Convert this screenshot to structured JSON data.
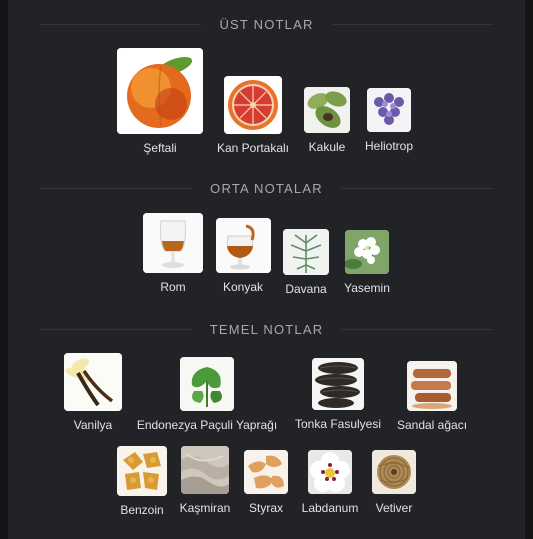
{
  "sections": {
    "top": {
      "title": "ÜST NOTLAR"
    },
    "middle": {
      "title": "ORTA NOTALAR"
    },
    "base": {
      "title": "TEMEL NOTLAR"
    }
  },
  "notes": {
    "top": [
      {
        "label": "Şeftali",
        "icon": "peach-icon"
      },
      {
        "label": "Kan Portakalı",
        "icon": "blood-orange-icon"
      },
      {
        "label": "Kakule",
        "icon": "cardamom-icon"
      },
      {
        "label": "Heliotrop",
        "icon": "heliotrope-icon"
      }
    ],
    "middle": [
      {
        "label": "Rom",
        "icon": "rum-glass-icon"
      },
      {
        "label": "Konyak",
        "icon": "cognac-glass-icon"
      },
      {
        "label": "Davana",
        "icon": "davana-icon"
      },
      {
        "label": "Yasemin",
        "icon": "jasmine-icon"
      }
    ],
    "base": [
      {
        "label": "Vanilya",
        "icon": "vanilla-icon"
      },
      {
        "label": "Endonezya Paçuli Yaprağı",
        "icon": "patchouli-leaf-icon"
      },
      {
        "label": "Tonka Fasulyesi",
        "icon": "tonka-bean-icon"
      },
      {
        "label": "Sandal ağacı",
        "icon": "sandalwood-icon"
      },
      {
        "label": "Benzoin",
        "icon": "benzoin-icon"
      },
      {
        "label": "Kaşmiran",
        "icon": "cashmeran-icon"
      },
      {
        "label": "Styrax",
        "icon": "styrax-icon"
      },
      {
        "label": "Labdanum",
        "icon": "labdanum-icon"
      },
      {
        "label": "Vetiver",
        "icon": "vetiver-icon"
      }
    ]
  }
}
